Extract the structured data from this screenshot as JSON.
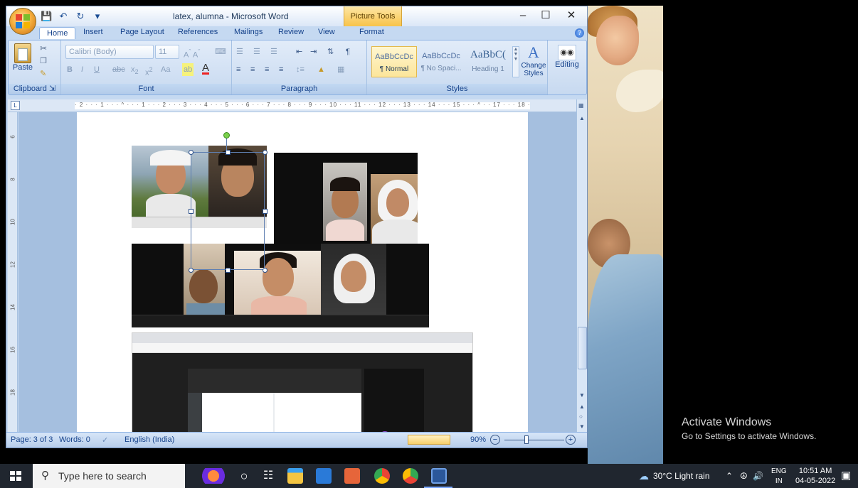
{
  "window": {
    "title": "latex, alumna - Microsoft Word",
    "contextual_tab": "Picture Tools",
    "minimize": "–",
    "maximize": "☐",
    "close": "✕"
  },
  "tabs": [
    {
      "label": "Home",
      "active": true
    },
    {
      "label": "Insert"
    },
    {
      "label": "Page Layout"
    },
    {
      "label": "References"
    },
    {
      "label": "Mailings"
    },
    {
      "label": "Review"
    },
    {
      "label": "View"
    },
    {
      "label": "Format"
    }
  ],
  "ribbon": {
    "clipboard": {
      "label": "Clipboard",
      "paste": "Paste"
    },
    "font": {
      "label": "Font",
      "family": "Calibri (Body)",
      "size": "11"
    },
    "paragraph": {
      "label": "Paragraph"
    },
    "styles": {
      "label": "Styles",
      "items": [
        {
          "sample": "AaBbCcDc",
          "name": "¶ Normal"
        },
        {
          "sample": "AaBbCcDc",
          "name": "¶ No Spaci..."
        },
        {
          "sample": "AaBbC(",
          "name": "Heading 1"
        }
      ],
      "change_styles": "Change Styles",
      "editing": "Editing"
    }
  },
  "status": {
    "page": "Page: 3 of 3",
    "words": "Words: 0",
    "language": "English (India)",
    "zoom": "90%"
  },
  "desktop": {
    "activate_title": "Activate Windows",
    "activate_sub": "Go to Settings to activate Windows."
  },
  "taskbar": {
    "search_placeholder": "Type here to search",
    "weather": "30°C  Light rain",
    "lang_top": "ENG",
    "lang_bottom": "IN",
    "time": "10:51 AM",
    "date": "04-05-2022"
  }
}
